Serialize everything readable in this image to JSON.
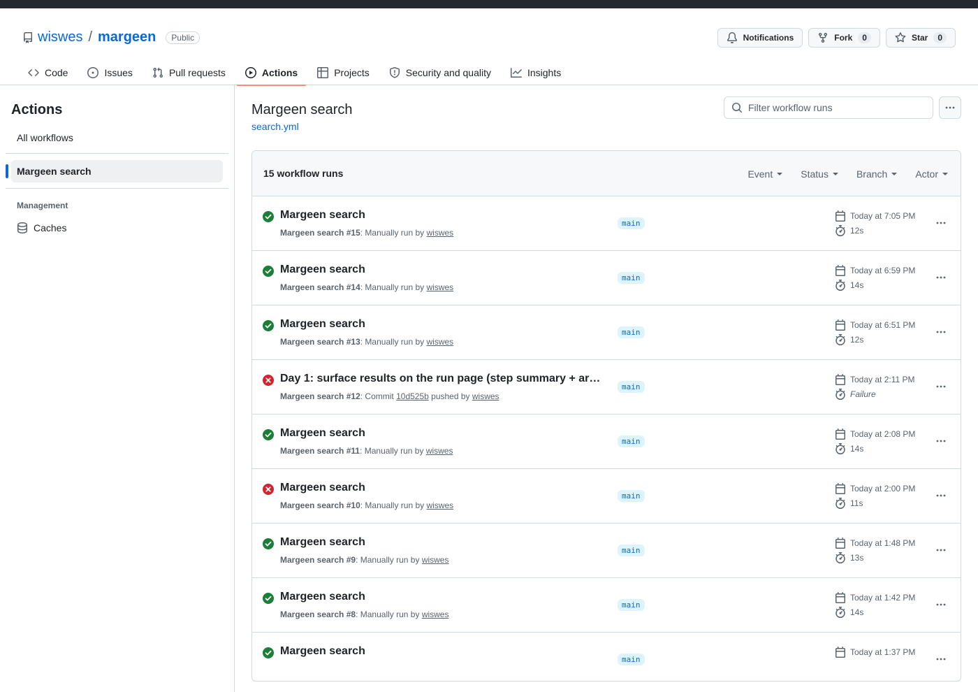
{
  "repo": {
    "owner": "wiswes",
    "separator": "/",
    "name": "margeen",
    "visibility": "Public"
  },
  "header_actions": {
    "notifications_label": "Notifications",
    "fork_label": "Fork",
    "fork_count": "0",
    "star_label": "Star",
    "star_count": "0"
  },
  "tabs": [
    {
      "label": "Code",
      "icon": "code-icon"
    },
    {
      "label": "Issues",
      "icon": "issue-icon"
    },
    {
      "label": "Pull requests",
      "icon": "pull-request-icon"
    },
    {
      "label": "Actions",
      "icon": "play-icon",
      "active": true
    },
    {
      "label": "Projects",
      "icon": "table-icon"
    },
    {
      "label": "Security and quality",
      "icon": "shield-icon"
    },
    {
      "label": "Insights",
      "icon": "graph-icon"
    }
  ],
  "sidebar": {
    "title": "Actions",
    "all_workflows": "All workflows",
    "selected_workflow": "Margeen search",
    "management_heading": "Management",
    "caches_label": "Caches"
  },
  "main": {
    "workflow_title": "Margeen search",
    "workflow_file": "search.yml",
    "filter_placeholder": "Filter workflow runs",
    "run_count": "15 workflow runs",
    "filters": [
      "Event",
      "Status",
      "Branch",
      "Actor"
    ]
  },
  "colors": {
    "success": "#1a7f37",
    "failure": "#d1242f",
    "accent": "#0969da",
    "tab_underline": "#fd8c73"
  },
  "runs": [
    {
      "status": "success",
      "title": "Margeen search",
      "workflow": "Margeen search",
      "number": "#15",
      "trigger": ": Manually run by ",
      "commit": "",
      "trigger_after": "",
      "actor": "wiswes",
      "branch": "main",
      "when": "Today at 7:05 PM",
      "duration": "12s"
    },
    {
      "status": "success",
      "title": "Margeen search",
      "workflow": "Margeen search",
      "number": "#14",
      "trigger": ": Manually run by ",
      "commit": "",
      "trigger_after": "",
      "actor": "wiswes",
      "branch": "main",
      "when": "Today at 6:59 PM",
      "duration": "14s"
    },
    {
      "status": "success",
      "title": "Margeen search",
      "workflow": "Margeen search",
      "number": "#13",
      "trigger": ": Manually run by ",
      "commit": "",
      "trigger_after": "",
      "actor": "wiswes",
      "branch": "main",
      "when": "Today at 6:51 PM",
      "duration": "12s"
    },
    {
      "status": "failure",
      "title": "Day 1: surface results on the run page (step summary + art...",
      "workflow": "Margeen search",
      "number": "#12",
      "trigger": ": Commit ",
      "commit": "10d525b",
      "trigger_after": " pushed by ",
      "actor": "wiswes",
      "branch": "main",
      "when": "Today at 2:11 PM",
      "duration": "Failure"
    },
    {
      "status": "success",
      "title": "Margeen search",
      "workflow": "Margeen search",
      "number": "#11",
      "trigger": ": Manually run by ",
      "commit": "",
      "trigger_after": "",
      "actor": "wiswes",
      "branch": "main",
      "when": "Today at 2:08 PM",
      "duration": "14s"
    },
    {
      "status": "failure",
      "title": "Margeen search",
      "workflow": "Margeen search",
      "number": "#10",
      "trigger": ": Manually run by ",
      "commit": "",
      "trigger_after": "",
      "actor": "wiswes",
      "branch": "main",
      "when": "Today at 2:00 PM",
      "duration": "11s"
    },
    {
      "status": "success",
      "title": "Margeen search",
      "workflow": "Margeen search",
      "number": "#9",
      "trigger": ": Manually run by ",
      "commit": "",
      "trigger_after": "",
      "actor": "wiswes",
      "branch": "main",
      "when": "Today at 1:48 PM",
      "duration": "13s"
    },
    {
      "status": "success",
      "title": "Margeen search",
      "workflow": "Margeen search",
      "number": "#8",
      "trigger": ": Manually run by ",
      "commit": "",
      "trigger_after": "",
      "actor": "wiswes",
      "branch": "main",
      "when": "Today at 1:42 PM",
      "duration": "14s"
    },
    {
      "status": "success",
      "title": "Margeen search",
      "workflow": "",
      "number": "",
      "trigger": "",
      "commit": "",
      "trigger_after": "",
      "actor": "",
      "branch": "main",
      "when": "Today at 1:37 PM",
      "duration": ""
    }
  ]
}
